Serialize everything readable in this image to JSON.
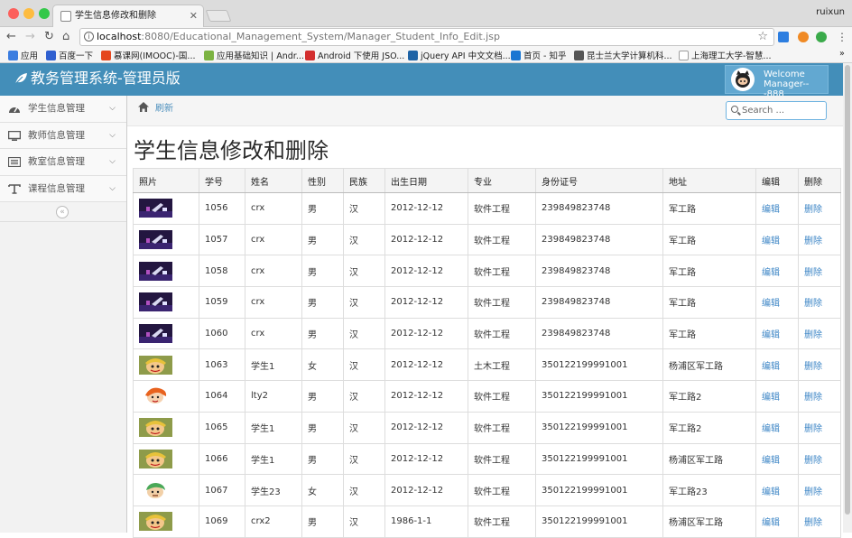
{
  "browser": {
    "tab_title": "学生信息修改和删除",
    "profile": "ruixun",
    "url_host": "localhost",
    "url_path": ":8080/Educational_Management_System/Manager_Student_Info_Edit.jsp",
    "bookmarks": [
      {
        "label": "应用",
        "color": "#3b7de0"
      },
      {
        "label": "百度一下",
        "color": "#3060d0"
      },
      {
        "label": "慕课网(IMOOC)-国...",
        "color": "#e5471e"
      },
      {
        "label": "应用基础知识 | Andr...",
        "color": "#7cb342"
      },
      {
        "label": "Android 下使用 JSO...",
        "color": "#d32f2f"
      },
      {
        "label": "jQuery API 中文文档...",
        "color": "#1e63a6"
      },
      {
        "label": "首页 - 知乎",
        "color": "#1976d2"
      },
      {
        "label": "昆士兰大学计算机科...",
        "color": "#555555"
      },
      {
        "label": "上海理工大学-智慧...",
        "color": "#9e9e9e"
      }
    ],
    "more": "»"
  },
  "header": {
    "brand": "教务管理系统-管理员版",
    "welcome_line1": "Welcome",
    "welcome_line2": "Manager---888",
    "bar_color": "#438eb9"
  },
  "sidebar": {
    "items": [
      {
        "label": "学生信息管理",
        "icon": "tachometer-icon"
      },
      {
        "label": "教师信息管理",
        "icon": "monitor-icon"
      },
      {
        "label": "教室信息管理",
        "icon": "list-icon"
      },
      {
        "label": "课程信息管理",
        "icon": "text-icon"
      }
    ],
    "collapse": "«"
  },
  "breadcrumb": {
    "refresh": "刷新"
  },
  "search": {
    "placeholder": "Search ..."
  },
  "page": {
    "title": "学生信息修改和删除"
  },
  "table": {
    "headers": [
      "照片",
      "学号",
      "姓名",
      "性别",
      "民族",
      "出生日期",
      "专业",
      "身份证号",
      "地址",
      "编辑",
      "删除"
    ],
    "rows": [
      {
        "photo": "stage",
        "id": "1056",
        "name": "crx",
        "gender": "男",
        "ethnicity": "汉",
        "birth": "2012-12-12",
        "major": "软件工程",
        "id_card": "239849823748",
        "address": "军工路",
        "edit": "编辑",
        "delete": "删除"
      },
      {
        "photo": "stage",
        "id": "1057",
        "name": "crx",
        "gender": "男",
        "ethnicity": "汉",
        "birth": "2012-12-12",
        "major": "软件工程",
        "id_card": "239849823748",
        "address": "军工路",
        "edit": "编辑",
        "delete": "删除"
      },
      {
        "photo": "stage",
        "id": "1058",
        "name": "crx",
        "gender": "男",
        "ethnicity": "汉",
        "birth": "2012-12-12",
        "major": "软件工程",
        "id_card": "239849823748",
        "address": "军工路",
        "edit": "编辑",
        "delete": "删除"
      },
      {
        "photo": "stage",
        "id": "1059",
        "name": "crx",
        "gender": "男",
        "ethnicity": "汉",
        "birth": "2012-12-12",
        "major": "软件工程",
        "id_card": "239849823748",
        "address": "军工路",
        "edit": "编辑",
        "delete": "删除"
      },
      {
        "photo": "stage",
        "id": "1060",
        "name": "crx",
        "gender": "男",
        "ethnicity": "汉",
        "birth": "2012-12-12",
        "major": "软件工程",
        "id_card": "239849823748",
        "address": "军工路",
        "edit": "编辑",
        "delete": "删除"
      },
      {
        "photo": "cartoon",
        "id": "1063",
        "name": "学生1",
        "gender": "女",
        "ethnicity": "汉",
        "birth": "2012-12-12",
        "major": "土木工程",
        "id_card": "350122199991001",
        "address": "杨浦区军工路",
        "edit": "编辑",
        "delete": "删除"
      },
      {
        "photo": "cartoon-orange",
        "id": "1064",
        "name": "lty2",
        "gender": "男",
        "ethnicity": "汉",
        "birth": "2012-12-12",
        "major": "软件工程",
        "id_card": "350122199991001",
        "address": "军工路2",
        "edit": "编辑",
        "delete": "删除"
      },
      {
        "photo": "cartoon",
        "id": "1065",
        "name": "学生1",
        "gender": "男",
        "ethnicity": "汉",
        "birth": "2012-12-12",
        "major": "软件工程",
        "id_card": "350122199991001",
        "address": "军工路2",
        "edit": "编辑",
        "delete": "删除"
      },
      {
        "photo": "cartoon",
        "id": "1066",
        "name": "学生1",
        "gender": "男",
        "ethnicity": "汉",
        "birth": "2012-12-12",
        "major": "软件工程",
        "id_card": "350122199991001",
        "address": "杨浦区军工路",
        "edit": "编辑",
        "delete": "删除"
      },
      {
        "photo": "cartoon-green",
        "id": "1067",
        "name": "学生23",
        "gender": "女",
        "ethnicity": "汉",
        "birth": "2012-12-12",
        "major": "软件工程",
        "id_card": "350122199991001",
        "address": "军工路23",
        "edit": "编辑",
        "delete": "删除"
      },
      {
        "photo": "cartoon",
        "id": "1069",
        "name": "crx2",
        "gender": "男",
        "ethnicity": "汉",
        "birth": "1986-1-1",
        "major": "软件工程",
        "id_card": "350122199991001",
        "address": "杨浦区军工路",
        "edit": "编辑",
        "delete": "删除"
      }
    ]
  }
}
